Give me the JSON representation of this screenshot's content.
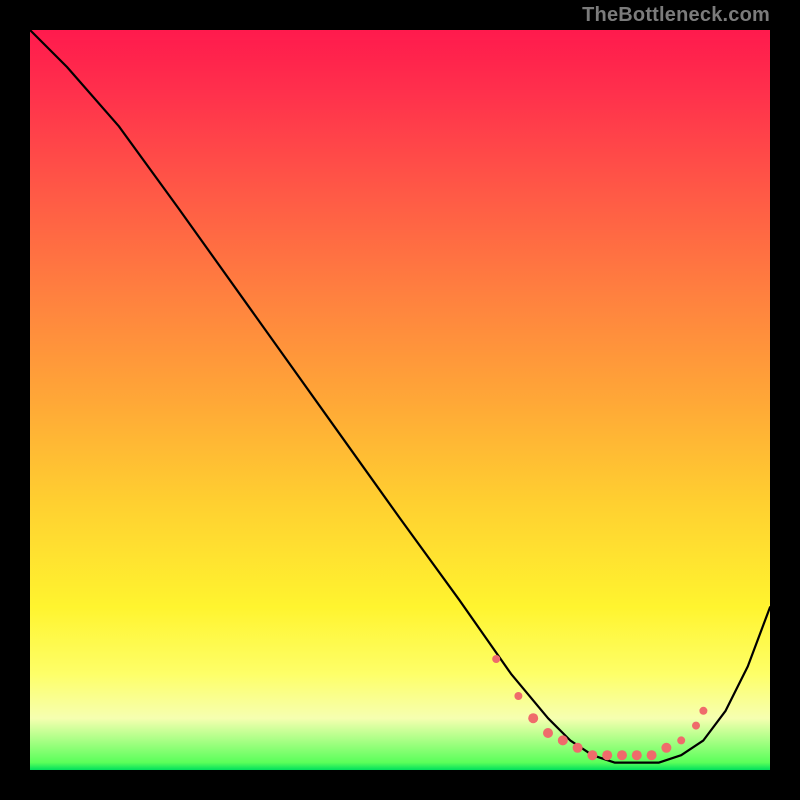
{
  "watermark": "TheBottleneck.com",
  "chart_data": {
    "type": "line",
    "title": "",
    "xlabel": "",
    "ylabel": "",
    "xlim": [
      0,
      100
    ],
    "ylim": [
      0,
      100
    ],
    "grid": false,
    "legend": false,
    "background_gradient": {
      "stops": [
        {
          "pos": 0,
          "color": "#ff1a4d"
        },
        {
          "pos": 50,
          "color": "#ffa737"
        },
        {
          "pos": 78,
          "color": "#fff42f"
        },
        {
          "pos": 93,
          "color": "#f6ffb0"
        },
        {
          "pos": 100,
          "color": "#00e05c"
        }
      ]
    },
    "series": [
      {
        "name": "curve",
        "color": "#000000",
        "x": [
          0,
          5,
          12,
          20,
          30,
          40,
          50,
          58,
          65,
          70,
          73,
          76,
          79,
          82,
          85,
          88,
          91,
          94,
          97,
          100
        ],
        "y": [
          100,
          95,
          87,
          76,
          62,
          48,
          34,
          23,
          13,
          7,
          4,
          2,
          1,
          1,
          1,
          2,
          4,
          8,
          14,
          22
        ]
      }
    ],
    "markers": {
      "color": "#ef6b6b",
      "points": [
        {
          "x": 63,
          "y": 15,
          "r": 4
        },
        {
          "x": 66,
          "y": 10,
          "r": 4
        },
        {
          "x": 68,
          "y": 7,
          "r": 5
        },
        {
          "x": 70,
          "y": 5,
          "r": 5
        },
        {
          "x": 72,
          "y": 4,
          "r": 5
        },
        {
          "x": 74,
          "y": 3,
          "r": 5
        },
        {
          "x": 76,
          "y": 2,
          "r": 5
        },
        {
          "x": 78,
          "y": 2,
          "r": 5
        },
        {
          "x": 80,
          "y": 2,
          "r": 5
        },
        {
          "x": 82,
          "y": 2,
          "r": 5
        },
        {
          "x": 84,
          "y": 2,
          "r": 5
        },
        {
          "x": 86,
          "y": 3,
          "r": 5
        },
        {
          "x": 88,
          "y": 4,
          "r": 4
        },
        {
          "x": 90,
          "y": 6,
          "r": 4
        },
        {
          "x": 91,
          "y": 8,
          "r": 4
        }
      ]
    }
  }
}
